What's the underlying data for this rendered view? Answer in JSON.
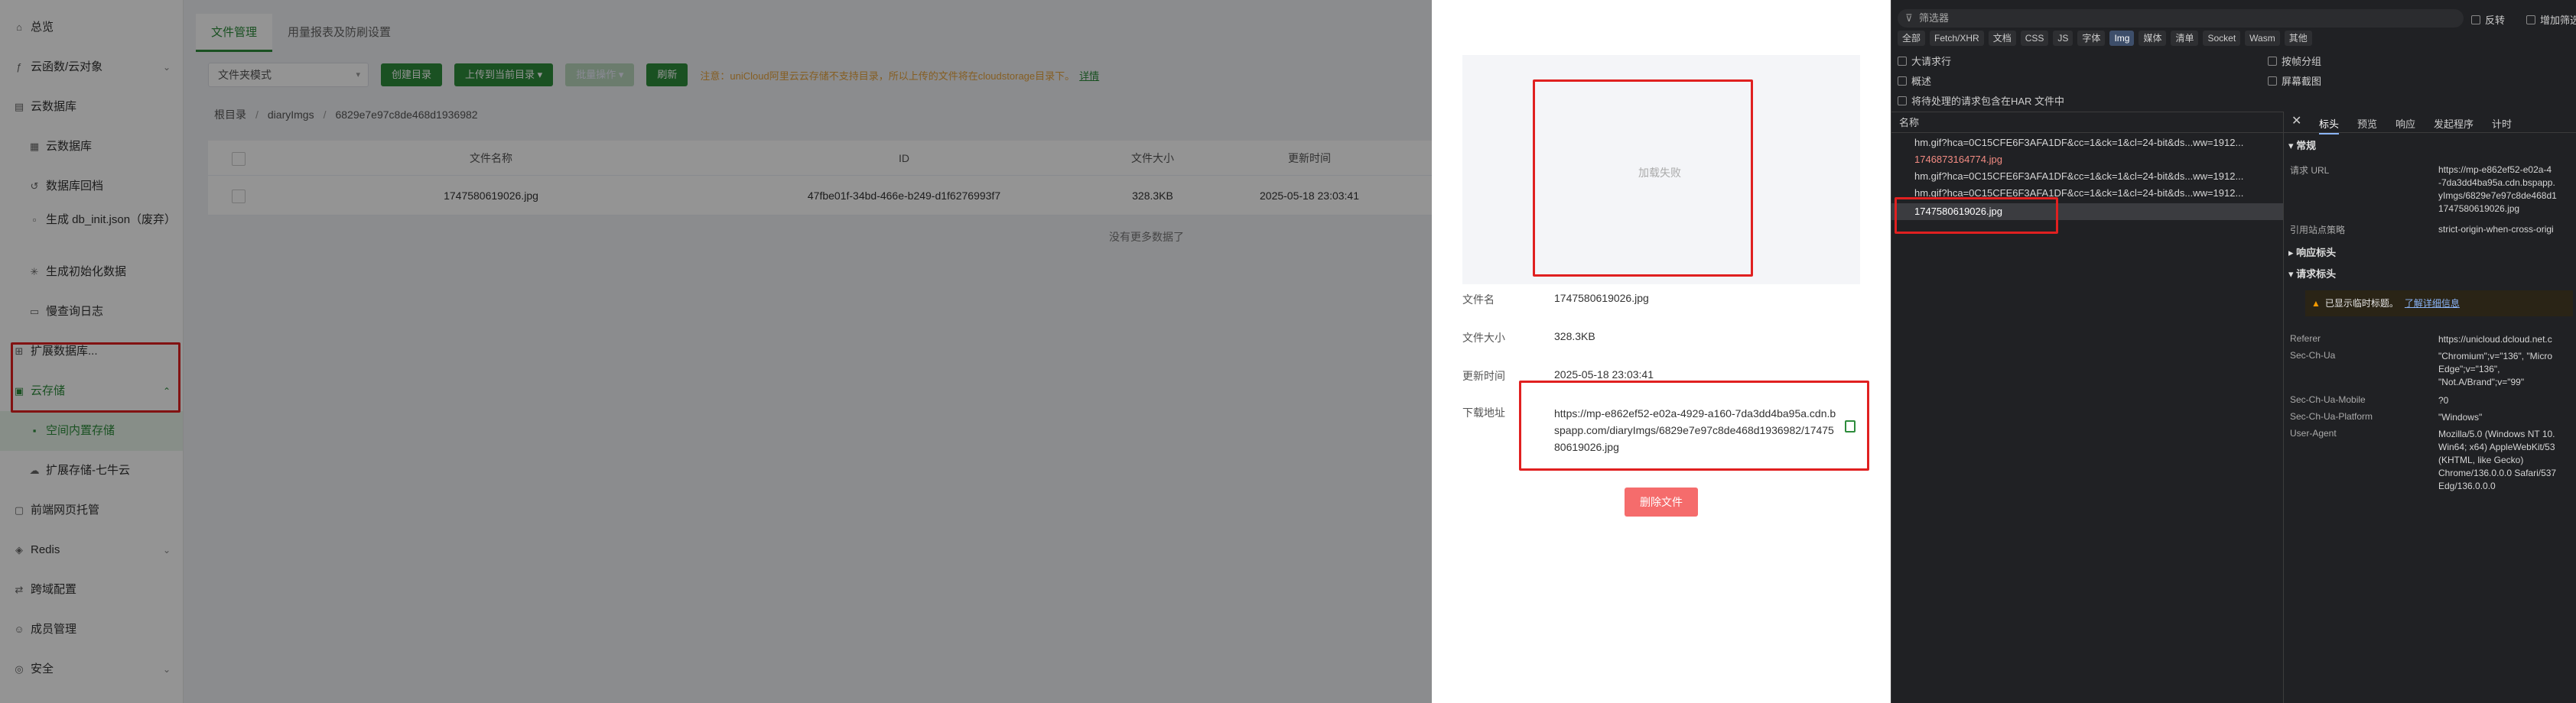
{
  "sidebar": {
    "items": [
      {
        "label": "总览",
        "icon": "home-icon"
      },
      {
        "label": "云函数/云对象",
        "icon": "function-icon"
      },
      {
        "label": "云数据库",
        "icon": "database-icon"
      },
      {
        "label": "云数据库",
        "icon": "table-icon"
      },
      {
        "label": "数据库回档",
        "icon": "rollback-icon"
      },
      {
        "label": "生成 db_init.json（废弃）",
        "icon": "file-icon"
      },
      {
        "label": "生成初始化数据",
        "icon": "generate-icon"
      },
      {
        "label": "慢查询日志",
        "icon": "log-icon"
      },
      {
        "label": "扩展数据库...",
        "icon": "extension-icon"
      },
      {
        "label": "云存储",
        "icon": "storage-icon"
      },
      {
        "label": "空间内置存储",
        "icon": "builtin-storage-icon"
      },
      {
        "label": "扩展存储-七牛云",
        "icon": "cloud-icon"
      },
      {
        "label": "前端网页托管",
        "icon": "web-hosting-icon"
      },
      {
        "label": "Redis",
        "icon": "redis-icon"
      },
      {
        "label": "跨域配置",
        "icon": "cors-icon"
      },
      {
        "label": "成员管理",
        "icon": "members-icon"
      },
      {
        "label": "安全",
        "icon": "security-icon"
      }
    ]
  },
  "tabs": [
    "文件管理",
    "用量报表及防刷设置"
  ],
  "toolbar": {
    "mode": "文件夹模式",
    "create_dir": "创建目录",
    "upload": "上传到当前目录",
    "batch": "批量操作",
    "refresh": "刷新",
    "notice": "注意：uniCloud阿里云云存储不支持目录，所以上传的文件将在cloudstorage目录下。",
    "notice_link": "详情"
  },
  "breadcrumb": {
    "root": "根目录",
    "level1": "diaryImgs",
    "level2": "6829e7e97c8de468d1936982"
  },
  "table": {
    "headers": [
      "文件名称",
      "ID",
      "文件大小",
      "更新时间"
    ],
    "rows": [
      {
        "name": "1747580619026.jpg",
        "id": "47fbe01f-34bd-466e-b249-d1f6276993f7",
        "size": "328.3KB",
        "time": "2025-05-18 23:03:41"
      }
    ],
    "empty": "没有更多数据了"
  },
  "drawer": {
    "preview_failed": "加载失败",
    "name_label": "文件名",
    "name": "1747580619026.jpg",
    "size_label": "文件大小",
    "size": "328.3KB",
    "time_label": "更新时间",
    "time": "2025-05-18 23:03:41",
    "url_label": "下载地址",
    "url": "https://mp-e862ef52-e02a-4929-a160-7da3dd4ba95a.cdn.bspapp.com/diaryImgs/6829e7e97c8de468d1936982/1747580619026.jpg",
    "delete": "删除文件"
  },
  "devtools": {
    "filter_placeholder": "筛选器",
    "invert": "反转",
    "more_filters": "增加筛选条件",
    "types": [
      "全部",
      "Fetch/XHR",
      "文档",
      "CSS",
      "JS",
      "字体",
      "Img",
      "媒体",
      "清单",
      "Socket",
      "Wasm",
      "其他"
    ],
    "opt_big_rows": "大请求行",
    "opt_group_frame": "按帧分组",
    "opt_overview": "概述",
    "opt_screenshot": "屏幕截图",
    "opt_har": "将待处理的请求包含在HAR 文件中",
    "name_header": "名称",
    "requests": [
      "hm.gif?hca=0C15CFE6F3AFA1DF&cc=1&ck=1&cl=24-bit&ds...ww=1912...",
      "1746873164774.jpg",
      "hm.gif?hca=0C15CFE6F3AFA1DF&cc=1&ck=1&cl=24-bit&ds...ww=1912...",
      "hm.gif?hca=0C15CFE6F3AFA1DF&cc=1&ck=1&cl=24-bit&ds...ww=1912...",
      "1747580619026.jpg"
    ],
    "detail_tabs": [
      "标头",
      "预览",
      "响应",
      "发起程序",
      "计时"
    ],
    "general": "常规",
    "request_url_label": "请求 URL",
    "request_url_lines": [
      "https://mp-e862ef52-e02a-4",
      "-7da3dd4ba95a.cdn.bspapp.",
      "yImgs/6829e7e97c8de468d1",
      "1747580619026.jpg"
    ],
    "referrer_policy_label": "引用站点策略",
    "referrer_policy": "strict-origin-when-cross-origi",
    "response_headers": "响应标头",
    "request_headers": "请求标头",
    "warning": "已显示临时标题。",
    "warning_link": "了解详细信息",
    "referer_label": "Referer",
    "referer": "https://unicloud.dcloud.net.c",
    "ua_label": "Sec-Ch-Ua",
    "ua_lines": [
      "\"Chromium\";v=\"136\", \"Micro",
      "Edge\";v=\"136\",",
      "\"Not.A/Brand\";v=\"99\""
    ],
    "mobile_label": "Sec-Ch-Ua-Mobile",
    "mobile": "?0",
    "platform_label": "Sec-Ch-Ua-Platform",
    "platform": "\"Windows\"",
    "useragent_label": "User-Agent",
    "useragent_lines": [
      "Mozilla/5.0 (Windows NT 10.",
      "Win64; x64) AppleWebKit/53",
      "(KHTML, like Gecko)",
      "Chrome/136.0.0.0 Safari/537",
      "Edg/136.0.0.0"
    ]
  },
  "colors": {
    "accent": "#2d8c3c",
    "danger": "#f56c6c",
    "highlight": "#e02020"
  }
}
